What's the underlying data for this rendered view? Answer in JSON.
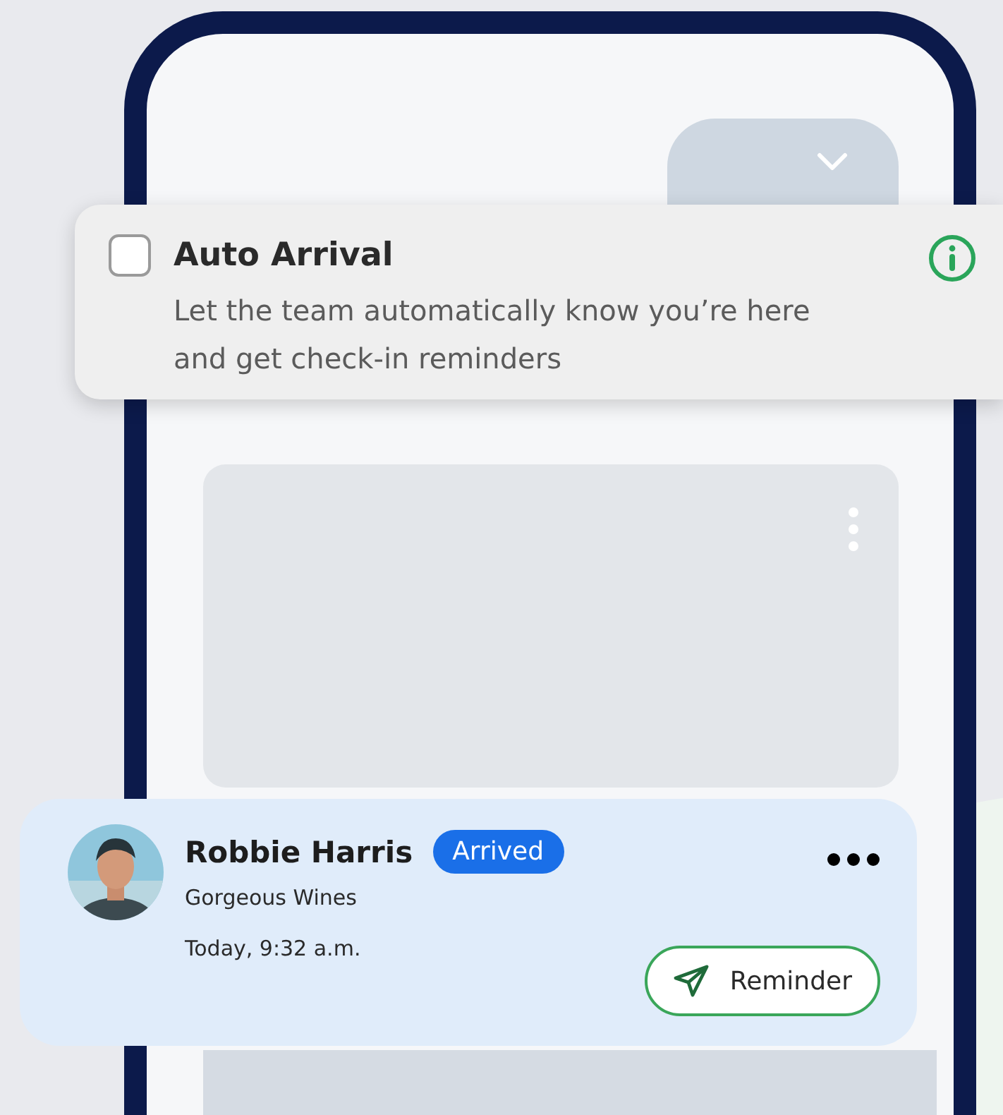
{
  "auto_arrival": {
    "checked": false,
    "title": "Auto Arrival",
    "description": "Let the team automatically know you’re here and get check-in reminders"
  },
  "contact": {
    "name": "Robbie Harris",
    "status": "Arrived",
    "company": "Gorgeous Wines",
    "time": "Today, 9:32 a.m.",
    "reminder_button": "Reminder"
  }
}
